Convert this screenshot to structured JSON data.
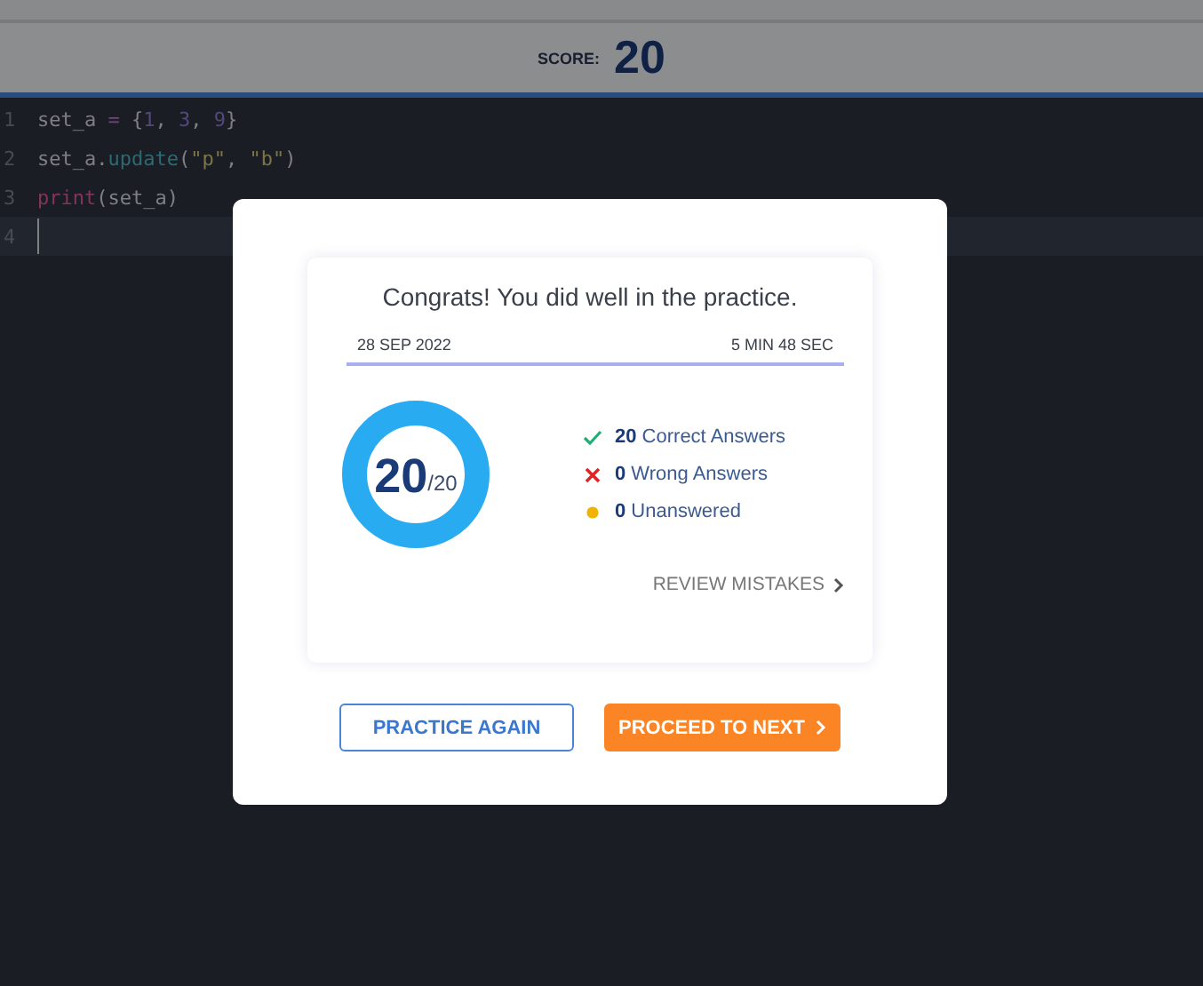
{
  "header": {
    "score_label": "SCORE:",
    "score": "20"
  },
  "editor": {
    "lines": [
      {
        "number": "1",
        "current": false,
        "tokens": [
          {
            "text": "set_a ",
            "kind": "plain"
          },
          {
            "text": "=",
            "kind": "operator"
          },
          {
            "text": " {",
            "kind": "plain"
          },
          {
            "text": "1",
            "kind": "number"
          },
          {
            "text": ", ",
            "kind": "plain"
          },
          {
            "text": "3",
            "kind": "number"
          },
          {
            "text": ", ",
            "kind": "plain"
          },
          {
            "text": "9",
            "kind": "number"
          },
          {
            "text": "}",
            "kind": "plain"
          }
        ]
      },
      {
        "number": "2",
        "current": false,
        "tokens": [
          {
            "text": "set_a.",
            "kind": "plain"
          },
          {
            "text": "update",
            "kind": "method"
          },
          {
            "text": "(",
            "kind": "plain"
          },
          {
            "text": "\"p\"",
            "kind": "string"
          },
          {
            "text": ", ",
            "kind": "plain"
          },
          {
            "text": "\"b\"",
            "kind": "string"
          },
          {
            "text": ")",
            "kind": "plain"
          }
        ]
      },
      {
        "number": "3",
        "current": false,
        "tokens": [
          {
            "text": "print",
            "kind": "builtin"
          },
          {
            "text": "(set_a)",
            "kind": "plain"
          }
        ]
      },
      {
        "number": "4",
        "current": true
      }
    ]
  },
  "dialog": {
    "title": "Congrats! You did well in the practice.",
    "date": "28 SEP 2022",
    "duration": "5 MIN 48 SEC",
    "result": {
      "score": "20",
      "total": "/20",
      "level": 1
    },
    "stats": [
      {
        "kind": "correct",
        "count": "20",
        "label": "Correct Answers"
      },
      {
        "kind": "wrong",
        "count": "0",
        "label": "Wrong Answers"
      },
      {
        "kind": "unanswered",
        "count": "0",
        "label": "Unanswered"
      }
    ],
    "review_link": "REVIEW MISTAKES",
    "buttons": [
      {
        "kind": "secondary",
        "label": "PRACTICE AGAIN"
      },
      {
        "kind": "primary",
        "label": "PROCEED TO NEXT"
      }
    ]
  }
}
